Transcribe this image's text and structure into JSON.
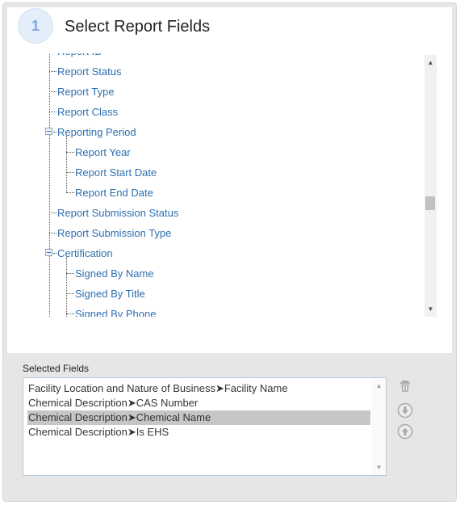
{
  "step": {
    "number": "1",
    "title": "Select Report Fields"
  },
  "tree": {
    "nodes": [
      {
        "label": "Report ID"
      },
      {
        "label": "Report Status"
      },
      {
        "label": "Report Type"
      },
      {
        "label": "Report Class"
      },
      {
        "label": "Reporting Period",
        "expanded": true
      },
      {
        "label": "Report Year"
      },
      {
        "label": "Report Start Date"
      },
      {
        "label": "Report End Date"
      },
      {
        "label": "Report Submission Status"
      },
      {
        "label": "Report Submission Type"
      },
      {
        "label": "Certification",
        "expanded": true
      },
      {
        "label": "Signed By Name"
      },
      {
        "label": "Signed By Title"
      },
      {
        "label": "Signed By Phone"
      }
    ]
  },
  "selected_fields": {
    "label": "Selected Fields",
    "items": [
      "Facility Location and Nature of Business➤Facility Name",
      "Chemical Description➤CAS Number",
      "Chemical Description➤Chemical Name",
      "Chemical Description➤Is EHS"
    ],
    "selected_index": 2
  },
  "icons": {
    "delete": "trash-icon",
    "move_down": "arrow-down-circle-icon",
    "move_up": "arrow-up-circle-icon",
    "scroll_up": "scroll-up-arrow-icon",
    "scroll_down": "scroll-down-arrow-icon"
  },
  "colors": {
    "link": "#2e6fb0",
    "panel": "#e6e6e6",
    "selected_row": "#c6c6c6",
    "step_badge": "#e3eefa"
  }
}
